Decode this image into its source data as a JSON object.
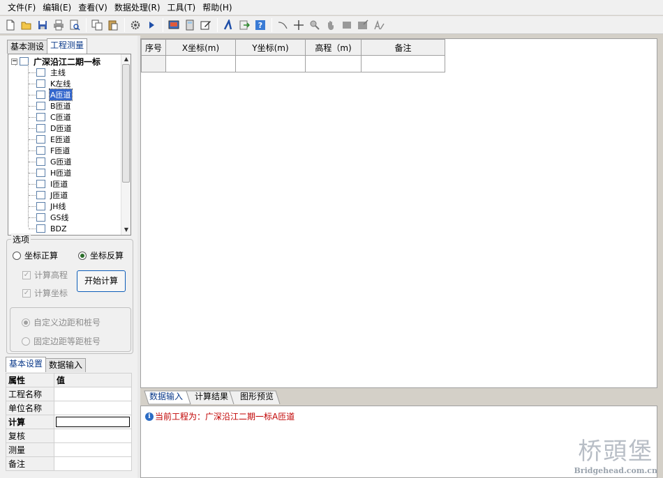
{
  "menu": [
    "文件(F)",
    "编辑(E)",
    "查看(V)",
    "数据处理(R)",
    "工具(T)",
    "帮助(H)"
  ],
  "toolbar_icons": [
    "new-file-icon",
    "open-folder-icon",
    "save-icon",
    "print-icon",
    "print-preview-icon",
    "copy-icon",
    "paste-icon",
    "settings-icon",
    "run-icon",
    "screen-icon",
    "calculator-icon",
    "edit-icon",
    "text-icon",
    "export-icon",
    "help-icon",
    "curve-icon",
    "crosshair-icon",
    "zoom-icon",
    "pan-hand-icon",
    "rectangle-icon",
    "image-icon",
    "font-icon"
  ],
  "left_tabs": {
    "basic": "基本测设",
    "engineering": "工程测量"
  },
  "tree": {
    "root": "广深沿江二期一标",
    "items": [
      "主线",
      "K左线",
      "A匝道",
      "B匝道",
      "C匝道",
      "D匝道",
      "E匝道",
      "F匝道",
      "G匝道",
      "H匝道",
      "I匝道",
      "J匝道",
      "JH线",
      "GS线",
      "BDZ"
    ],
    "selected_index": 2
  },
  "options": {
    "title": "选项",
    "forward": "坐标正算",
    "inverse": "坐标反算",
    "selected": "inverse",
    "calc_elevation": "计算高程",
    "calc_coords": "计算坐标",
    "start_button": "开始计算",
    "custom_margin": "自定义边距和桩号",
    "fixed_margin": "固定边距等距桩号"
  },
  "bottom_tabs": {
    "settings": "基本设置",
    "input": "数据输入"
  },
  "properties": {
    "header": {
      "key": "属性",
      "value": "值"
    },
    "rows": [
      "工程名称",
      "单位名称",
      "计算",
      "复核",
      "测量",
      "备注"
    ]
  },
  "grid": {
    "columns": [
      "序号",
      "X坐标(m)",
      "Y坐标(m)",
      "高程（m)",
      "备注"
    ]
  },
  "output_tabs": [
    "数据输入",
    "计算结果",
    "图形预览"
  ],
  "output": {
    "message": "当前工程为：广深沿江二期一标A匝道"
  },
  "watermark": {
    "line1": "桥頭堡",
    "line2": "Bridgehead.com.cn"
  }
}
